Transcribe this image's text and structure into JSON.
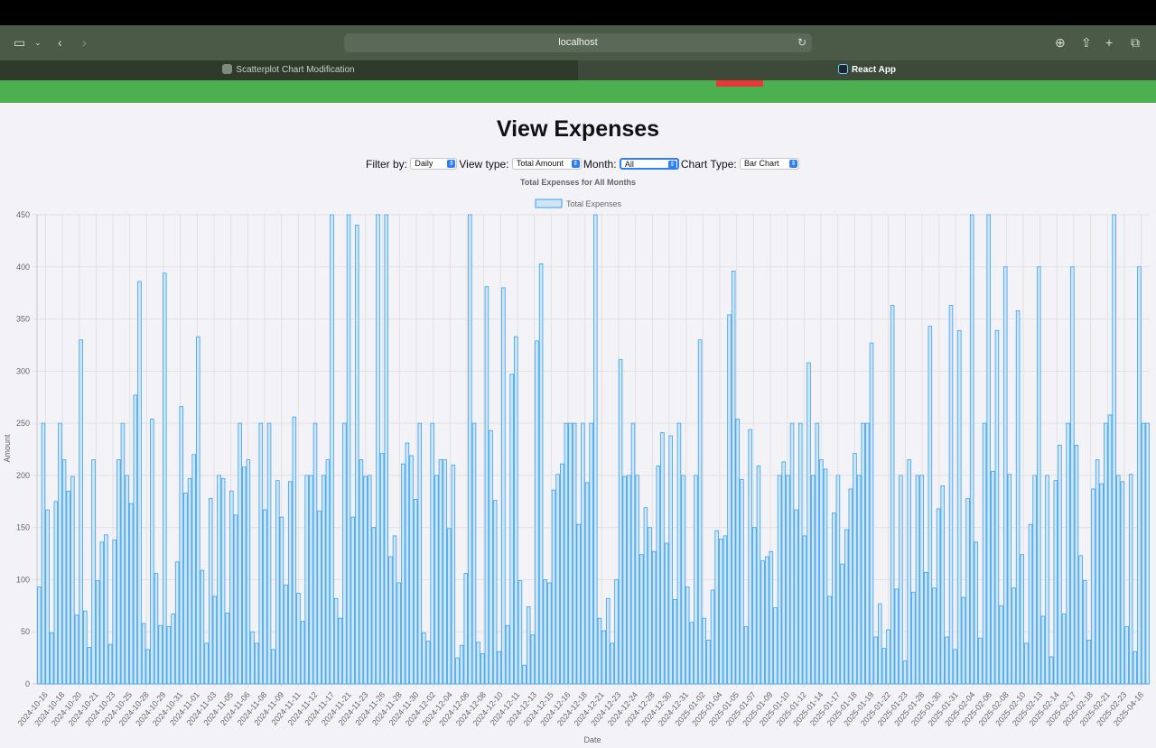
{
  "browser": {
    "url": "localhost",
    "tabs": [
      {
        "label": "Scatterplot Chart Modification",
        "active": false
      },
      {
        "label": "React App",
        "active": true
      }
    ]
  },
  "page": {
    "title": "View Expenses",
    "filters": {
      "filter_by_label": "Filter by:",
      "filter_by_value": "Daily",
      "view_type_label": "View type:",
      "view_type_value": "Total Amount",
      "month_label": "Month:",
      "month_value": "All",
      "chart_type_label": "Chart Type:",
      "chart_type_value": "Bar Chart"
    }
  },
  "colors": {
    "nav_green": "#4caf50",
    "bar_fill": "#cfe5f6",
    "bar_stroke": "#36a2eb",
    "logout_red": "#e53935"
  },
  "chart_data": {
    "type": "bar",
    "title": "Total Expenses for All Months",
    "xlabel": "Date",
    "ylabel": "Amount",
    "ylim": [
      0,
      450
    ],
    "yticks": [
      0,
      50,
      100,
      150,
      200,
      250,
      300,
      350,
      400,
      450
    ],
    "legend": "top",
    "grid": true,
    "series": [
      {
        "name": "Total Expenses"
      }
    ],
    "tick_labels": [
      "2024-10-16",
      "2024-10-18",
      "2024-10-20",
      "2024-10-21",
      "2024-10-23",
      "2024-10-25",
      "2024-10-28",
      "2024-10-29",
      "2024-10-31",
      "2024-11-01",
      "2024-11-03",
      "2024-11-05",
      "2024-11-06",
      "2024-11-08",
      "2024-11-09",
      "2024-11-11",
      "2024-11-12",
      "2024-11-17",
      "2024-11-21",
      "2024-11-23",
      "2024-11-26",
      "2024-11-28",
      "2024-11-30",
      "2024-12-02",
      "2024-12-04",
      "2024-12-06",
      "2024-12-08",
      "2024-12-10",
      "2024-12-11",
      "2024-12-13",
      "2024-12-15",
      "2024-12-16",
      "2024-12-18",
      "2024-12-21",
      "2024-12-23",
      "2024-12-24",
      "2024-12-28",
      "2024-12-30",
      "2024-12-31",
      "2025-01-02",
      "2025-01-04",
      "2025-01-05",
      "2025-01-07",
      "2025-01-09",
      "2025-01-10",
      "2025-01-12",
      "2025-01-14",
      "2025-01-17",
      "2025-01-18",
      "2025-01-19",
      "2025-01-22",
      "2025-01-23",
      "2025-01-28",
      "2025-01-30",
      "2025-01-31",
      "2025-02-04",
      "2025-02-06",
      "2025-02-08",
      "2025-02-10",
      "2025-02-13",
      "2025-02-14",
      "2025-02-17",
      "2025-02-18",
      "2025-02-21",
      "2025-02-23",
      "2025-04-16"
    ],
    "values": [
      93,
      250,
      167,
      49,
      175,
      250,
      215,
      185,
      199,
      66,
      330,
      70,
      35,
      215,
      99,
      136,
      143,
      38,
      138,
      215,
      250,
      200,
      173,
      277,
      386,
      58,
      33,
      254,
      106,
      56,
      394,
      55,
      67,
      117,
      266,
      183,
      197,
      220,
      333,
      109,
      39,
      178,
      84,
      200,
      197,
      68,
      185,
      162,
      250,
      208,
      215,
      50,
      39,
      250,
      167,
      250,
      33,
      195,
      160,
      95,
      194,
      256,
      87,
      60,
      200,
      200,
      250,
      166,
      200,
      215,
      450,
      82,
      63,
      250,
      450,
      160,
      440,
      215,
      199,
      200,
      150,
      450,
      221,
      450,
      122,
      142,
      97,
      211,
      231,
      219,
      177,
      250,
      49,
      41,
      250,
      200,
      215,
      215,
      149,
      210,
      25,
      37,
      106,
      450,
      250,
      40,
      29,
      381,
      243,
      176,
      31,
      380,
      56,
      297,
      333,
      99,
      18,
      74,
      47,
      329,
      403,
      100,
      97,
      186,
      201,
      211,
      250,
      250,
      250,
      153,
      250,
      193,
      250,
      450,
      63,
      51,
      82,
      39,
      100,
      311,
      199,
      200,
      250,
      200,
      124,
      169,
      150,
      127,
      209,
      241,
      135,
      238,
      81,
      250,
      200,
      93,
      59,
      200,
      330,
      63,
      42,
      90,
      147,
      139,
      142,
      354,
      396,
      254,
      196,
      55,
      244,
      150,
      209,
      118,
      122,
      127,
      73,
      200,
      213,
      200,
      250,
      167,
      250,
      142,
      308,
      200,
      250,
      215,
      206,
      84,
      164,
      200,
      115,
      148,
      187,
      221,
      200,
      250,
      250,
      327,
      45,
      77,
      34,
      52,
      363,
      91,
      200,
      22,
      215,
      88,
      200,
      200,
      107,
      343,
      92,
      168,
      190,
      45,
      363,
      33,
      339,
      83,
      178,
      450,
      136,
      44,
      250,
      450,
      204,
      339,
      75,
      400,
      201,
      92,
      358,
      124,
      39,
      153,
      200,
      400,
      65,
      200,
      26,
      195,
      229,
      67,
      250,
      400,
      229,
      123,
      99,
      42,
      187,
      215,
      192,
      250,
      258,
      450,
      200,
      194,
      55,
      201,
      31,
      400,
      250,
      250
    ]
  }
}
